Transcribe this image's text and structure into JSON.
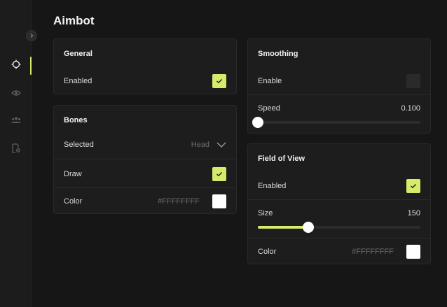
{
  "page": {
    "title": "Aimbot"
  },
  "colors": {
    "accent": "#d4ec6a",
    "background": "#161616",
    "card": "#1d1d1d"
  },
  "sidebar": {
    "items": [
      {
        "icon": "crosshair-icon",
        "active": true
      },
      {
        "icon": "eye-icon",
        "active": false
      },
      {
        "icon": "users-icon",
        "active": false
      },
      {
        "icon": "file-settings-icon",
        "active": false
      }
    ]
  },
  "general": {
    "title": "General",
    "enabled_label": "Enabled",
    "enabled": true
  },
  "bones": {
    "title": "Bones",
    "selected_label": "Selected",
    "selected_value": "Head",
    "draw_label": "Draw",
    "draw": true,
    "color_label": "Color",
    "color_value": "#FFFFFFFF"
  },
  "smoothing": {
    "title": "Smoothing",
    "enable_label": "Enable",
    "enable": false,
    "speed_label": "Speed",
    "speed_value": "0.100",
    "speed_fraction": 0.0
  },
  "fov": {
    "title": "Field of View",
    "enabled_label": "Enabled",
    "enabled": true,
    "size_label": "Size",
    "size_value": "150",
    "size_fraction": 0.31,
    "color_label": "Color",
    "color_value": "#FFFFFFFF"
  }
}
